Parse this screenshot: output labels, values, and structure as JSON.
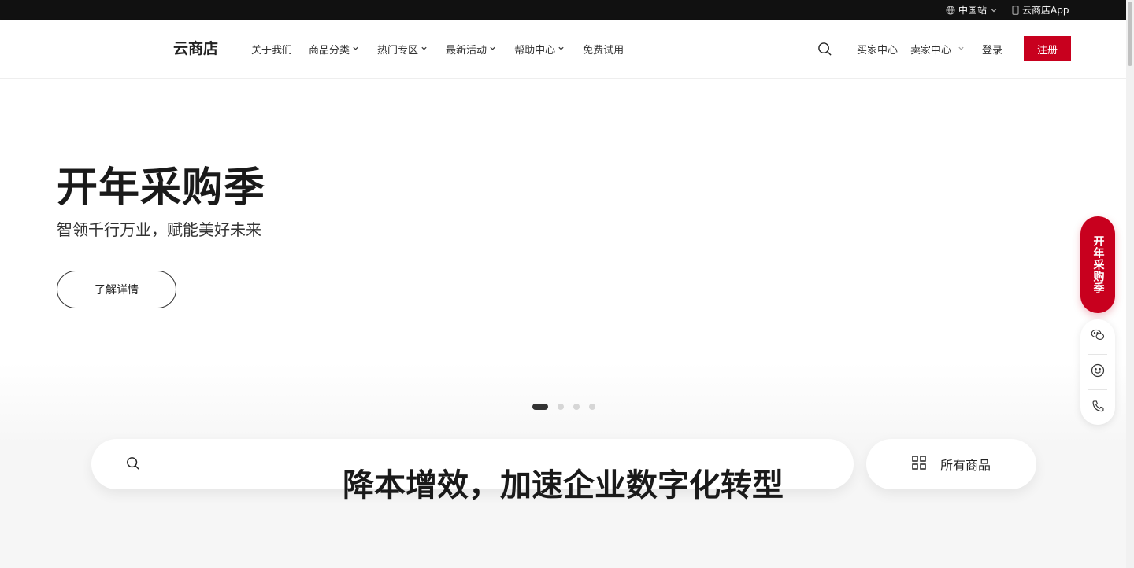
{
  "topbar": {
    "site_label": "中国站",
    "app_label": "云商店App"
  },
  "header": {
    "logo": "云商店",
    "nav": [
      {
        "label": "关于我们",
        "has_dropdown": false
      },
      {
        "label": "商品分类",
        "has_dropdown": true
      },
      {
        "label": "热门专区",
        "has_dropdown": true
      },
      {
        "label": "最新活动",
        "has_dropdown": true
      },
      {
        "label": "帮助中心",
        "has_dropdown": true
      },
      {
        "label": "免费试用",
        "has_dropdown": false
      }
    ],
    "buyer_center": "买家中心",
    "seller_center": "卖家中心",
    "login": "登录",
    "register": "注册"
  },
  "hero": {
    "title": "开年采购季",
    "subtitle": "智领千行万业，赋能美好未来",
    "cta": "了解详情",
    "slide_count": 4,
    "active_slide": 1
  },
  "search": {
    "placeholder": "",
    "all_products": "所有商品"
  },
  "section": {
    "title": "降本增效，加速企业数字化转型"
  },
  "float": {
    "promo": "开年采购季",
    "buttons": [
      "wechat-icon",
      "smiley-icon",
      "phone-icon"
    ]
  },
  "colors": {
    "brand": "#c8001e",
    "topbar_bg": "#111111"
  }
}
